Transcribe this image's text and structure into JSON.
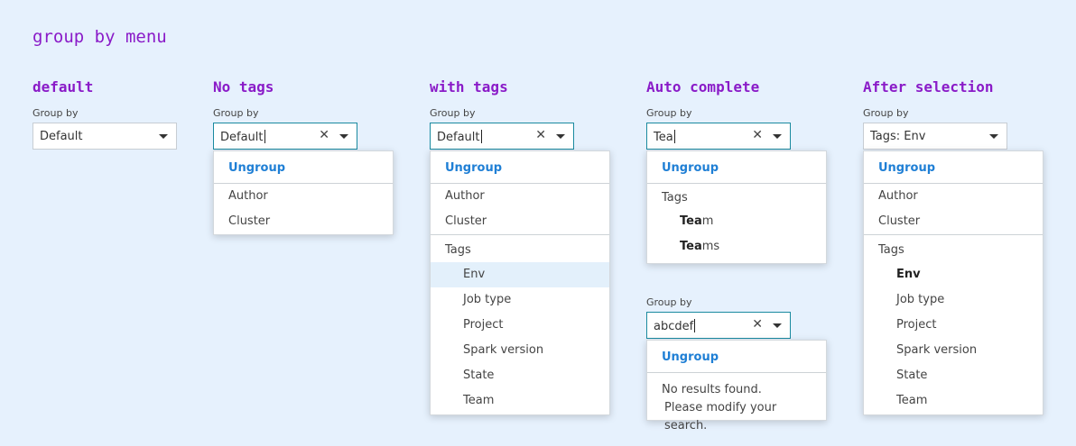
{
  "page": {
    "title": "group by menu"
  },
  "columns": {
    "default": {
      "title": "default",
      "label": "Group by",
      "value": "Default"
    },
    "no_tags": {
      "title": "No tags",
      "label": "Group by",
      "value": "Default",
      "menu": {
        "ungroup": "Ungroup",
        "items": [
          "Author",
          "Cluster"
        ]
      }
    },
    "with_tags": {
      "title": "with tags",
      "label": "Group by",
      "value": "Default",
      "menu": {
        "ungroup": "Ungroup",
        "items": [
          "Author",
          "Cluster"
        ],
        "tags_header": "Tags",
        "tags": [
          "Env",
          "Job type",
          "Project",
          "Spark version",
          "State",
          "Team"
        ],
        "highlighted": "Env"
      }
    },
    "auto_complete": {
      "title": "Auto complete",
      "label": "Group by",
      "value": "Tea",
      "menu": {
        "ungroup": "Ungroup",
        "tags_header": "Tags",
        "tags": [
          {
            "match": "Tea",
            "rest": "m"
          },
          {
            "match": "Tea",
            "rest": "ms"
          }
        ]
      },
      "second": {
        "label": "Group by",
        "value": "abcdef",
        "menu": {
          "ungroup": "Ungroup",
          "empty_line1": "No results found.",
          "empty_line2": "Please modify your search."
        }
      }
    },
    "after_selection": {
      "title": "After selection",
      "label": "Group by",
      "value": "Tags: Env",
      "menu": {
        "ungroup": "Ungroup",
        "items": [
          "Author",
          "Cluster"
        ],
        "tags_header": "Tags",
        "tags": [
          "Env",
          "Job type",
          "Project",
          "Spark version",
          "State",
          "Team"
        ],
        "selected": "Env"
      }
    }
  },
  "colors": {
    "title": "#8a1bc8",
    "accent": "#1f7fd5",
    "background": "#e6f1fd",
    "focus_border": "#1a8aa0",
    "highlight_row": "#e3f0fb"
  }
}
